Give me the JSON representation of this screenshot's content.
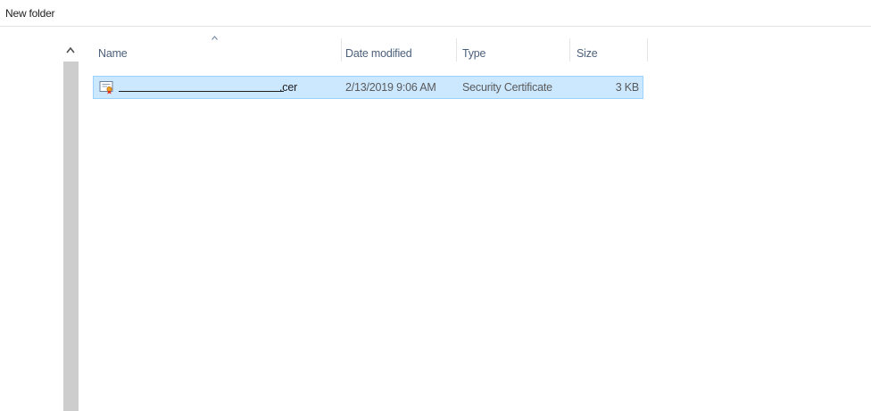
{
  "toolbar": {
    "new_folder_label": "New folder"
  },
  "columns": {
    "name": "Name",
    "date_modified": "Date modified",
    "type": "Type",
    "size": "Size"
  },
  "files": [
    {
      "name_extension": ".cer",
      "date_modified": "2/13/2019 9:06 AM",
      "type": "Security Certificate",
      "size": "3 KB",
      "icon": "certificate-icon",
      "selected": true
    }
  ],
  "colors": {
    "selection_bg": "#cce8ff",
    "selection_border": "#99d1ff",
    "header_text": "#4c607a",
    "scrollbar": "#cdcdcd"
  }
}
